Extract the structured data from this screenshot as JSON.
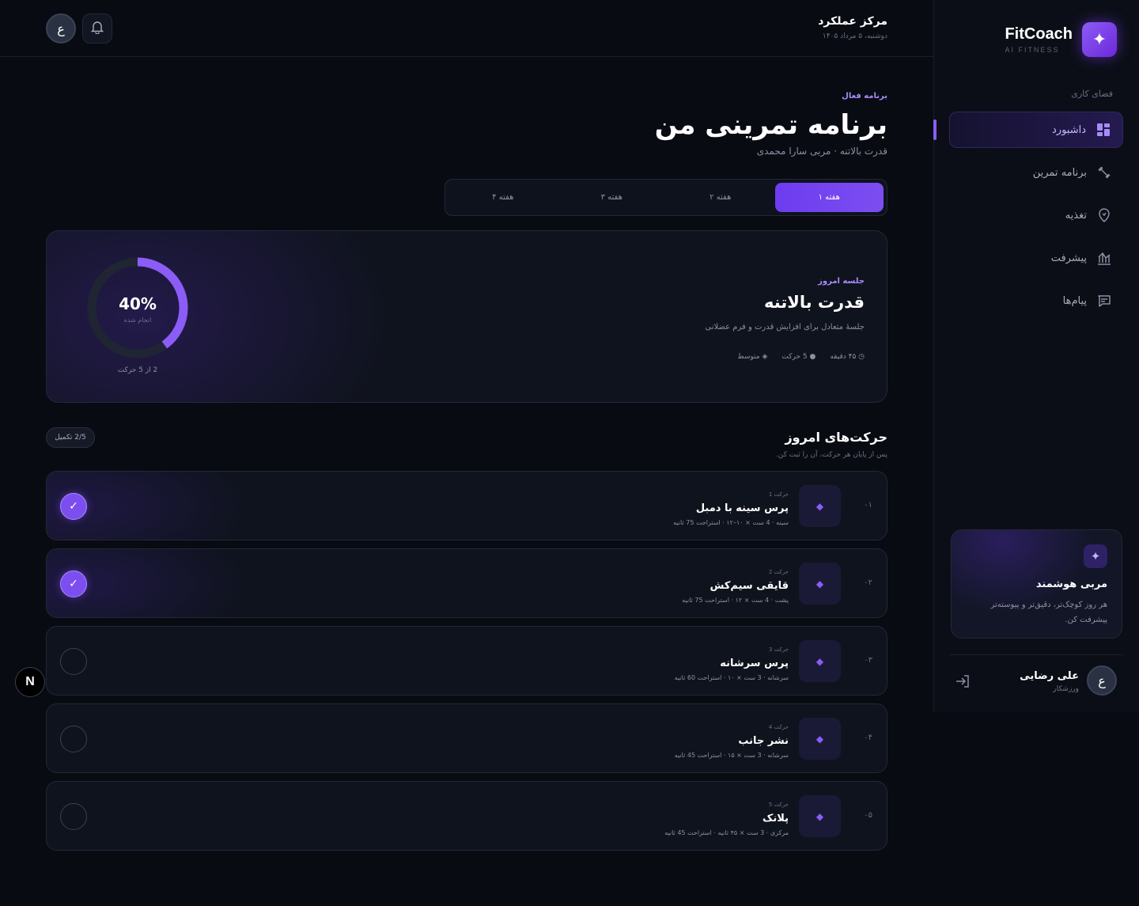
{
  "sidebar": {
    "brand_name": "FitCoach",
    "brand_sub": "AI FITNESS",
    "workspace_label": "فضای کاری",
    "items": [
      {
        "label": "داشبورد",
        "icon": "dashboard-icon",
        "active": true
      },
      {
        "label": "برنامه تمرین",
        "icon": "dumbbell-icon",
        "active": false
      },
      {
        "label": "تغذیه",
        "icon": "nutrition-icon",
        "active": false
      },
      {
        "label": "پیشرفت",
        "icon": "chart-icon",
        "active": false
      },
      {
        "label": "پیام‌ها",
        "icon": "message-icon",
        "active": false
      }
    ],
    "ai_card": {
      "title": "مربی هوشمند",
      "desc": "هر روز کوچک‌تر، دقیق‌تر و پیوسته‌تر پیشرفت کن."
    },
    "user": {
      "avatar": "ع",
      "name": "علی رضایی",
      "role": "ورزشکار"
    }
  },
  "header": {
    "title": "مرکز عملکرد",
    "date": "دوشنبه، ۵ مرداد ۱۴۰۵",
    "avatar": "ع"
  },
  "page": {
    "eyebrow": "برنامه فعال",
    "title": "برنامه تمرینی من",
    "subtitle": "قدرت بالاتنه · مربی سارا محمدی"
  },
  "tabs": [
    "هفته ۱",
    "هفته ۲",
    "هفته ۳",
    "هفته ۴"
  ],
  "session": {
    "eyebrow": "جلسه امروز",
    "title": "قدرت بالاتنه",
    "desc": "جلسهٔ متعادل برای افزایش قدرت و فرم عضلانی",
    "meta": [
      "◷ ۴۵ دقیقه",
      "● 5 حرکت",
      "◈ متوسط"
    ],
    "progress": 0.4,
    "progress_text": "40%",
    "progress_label": "انجام شده",
    "progress_caption": "2 از 5 حرکت"
  },
  "exercises_section": {
    "title": "حرکت‌های امروز",
    "subtitle": "پس از پایان هر حرکت، آن را ثبت کن.",
    "badge": "2/5 تکمیل"
  },
  "exercises": [
    {
      "num": "۰۱",
      "idx": "حرکت 1",
      "name": "پرس سینه با دمبل",
      "detail": "سینه · 4 ست × ۱۰–۱۲ · استراحت 75 ثانیه",
      "done": true
    },
    {
      "num": "۰۲",
      "idx": "حرکت 2",
      "name": "قایقی سیم‌کش",
      "detail": "پشت · 4 ست × ۱۲ · استراحت 75 ثانیه",
      "done": true
    },
    {
      "num": "۰۳",
      "idx": "حرکت 3",
      "name": "پرس سرشانه",
      "detail": "سرشانه · 3 ست × ۱۰ · استراحت 60 ثانیه",
      "done": false
    },
    {
      "num": "۰۴",
      "idx": "حرکت 4",
      "name": "نشر جانب",
      "detail": "سرشانه · 3 ست × ۱۵ · استراحت 45 ثانیه",
      "done": false
    },
    {
      "num": "۰۵",
      "idx": "حرکت 5",
      "name": "پلانک",
      "detail": "مرکزی · 3 ست × ۴۵ ثانیه · استراحت 45 ثانیه",
      "done": false
    }
  ],
  "colors": {
    "accent": "#7c4ef0",
    "bg": "#080b12",
    "card": "#0f131d"
  }
}
